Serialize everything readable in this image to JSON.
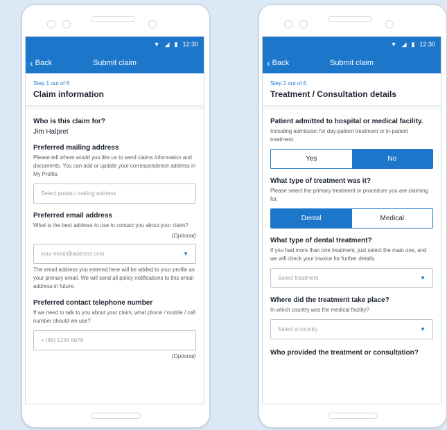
{
  "status": {
    "time": "12:30"
  },
  "phone1": {
    "back": "Back",
    "title": "Submit claim",
    "step": "Step 1 out of 6",
    "section": "Claim information",
    "who_q": "Who is this claim for?",
    "who_a": "Jim Halpret",
    "mail_q": "Preferred mailing address",
    "mail_help": "Please tell where would you like us to send claims information and documents. You can add or update your correspondence address in My Profile.",
    "mail_placeholder": "Select postal / mailing address",
    "email_q": "Preferred email address",
    "email_help": "What is the best address to use to contact you about your claim?",
    "email_optional": "(Optional)",
    "email_placeholder": "your-email@address.com",
    "email_note": "The email address you entered here will be added to your profile as your primary email. We will send all policy notifications to this email address in future.",
    "phone_q": "Preferred contact telephone number",
    "phone_help": "If we need to talk to you about your claim, what phone / mobile / cell number should we use?",
    "phone_placeholder": "+ (99) 1234 5678",
    "phone_optional": "(Optional)"
  },
  "phone2": {
    "back": "Back",
    "title": "Submit claim",
    "step": "Step 2 out of 6",
    "section": "Treatment / Consultation details",
    "admit_q": "Patient admitted to hospital or medical facility.",
    "admit_help": "Including admission for day-patient treatment or in-patient treatment.",
    "yes": "Yes",
    "no": "No",
    "type_q": "What type of treatment was it?",
    "type_help": "Please select the primary treatment or procedure you are claiming for.",
    "dental": "Dental",
    "medical": "Medical",
    "dental_q": "What type of dental treatment?",
    "dental_help": "If you had more than one treatment, just select the main one, and we will check your invoice for further details.",
    "treatment_placeholder": "Select treatment",
    "where_q": "Where did the treatment take place?",
    "where_help": "In which country was the medical facility?",
    "country_placeholder": "Select a country",
    "who_q": "Who provided the treatment or consultation?"
  },
  "colors": {
    "accent": "#1c76c9"
  }
}
